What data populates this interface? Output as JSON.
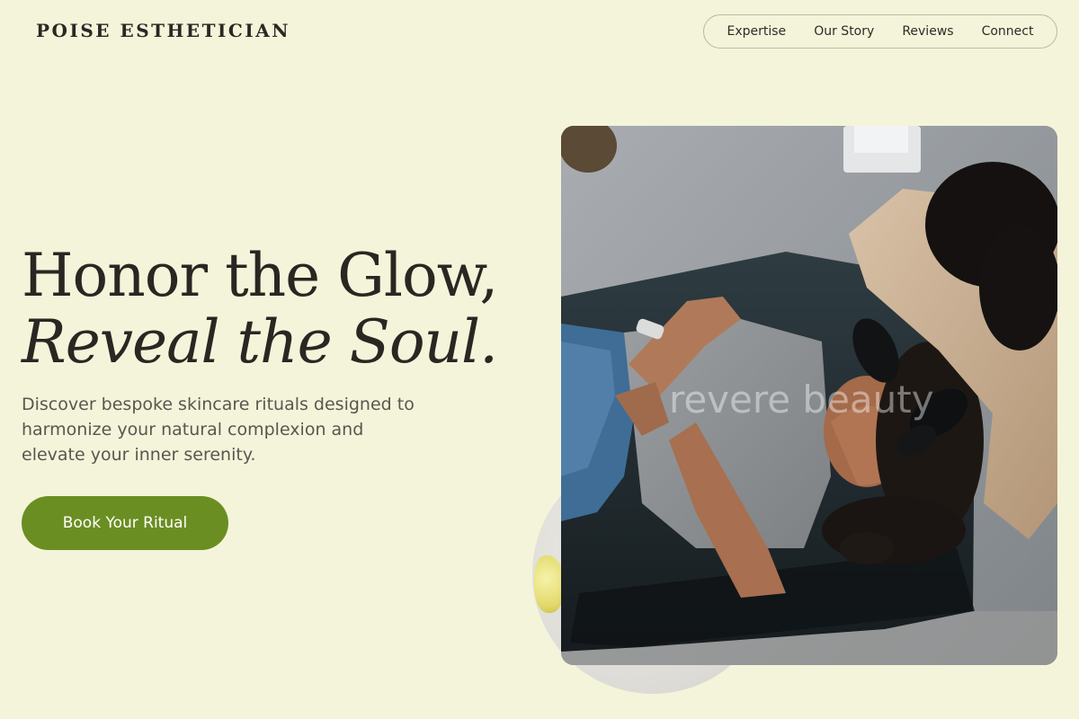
{
  "brand": {
    "name": "POISE ESTHETICIAN"
  },
  "nav": {
    "items": [
      "Expertise",
      "Our Story",
      "Reviews",
      "Connect"
    ]
  },
  "hero": {
    "title_line1": "Honor the Glow,",
    "title_line2": "Reveal the Soul.",
    "subtitle": "Discover bespoke skincare rituals designed to harmonize your natural complexion and elevate your inner serenity.",
    "cta_label": "Book Your Ritual"
  },
  "photo": {
    "watermark": "revere beauty"
  },
  "colors": {
    "background": "#f4f4da",
    "accent": "#6b8e23",
    "text": "#2a2622"
  }
}
